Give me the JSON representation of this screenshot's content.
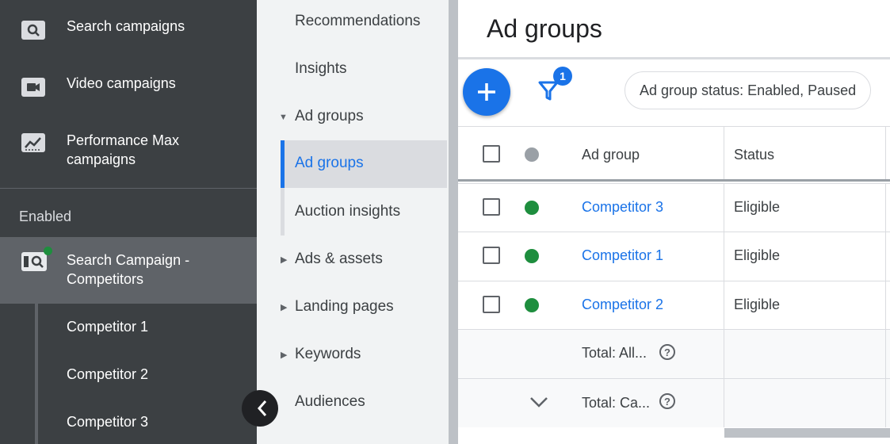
{
  "sidebar": {
    "campaign_types": [
      {
        "label_line1": "Search campaigns",
        "label_line2": "",
        "icon": "search-icon"
      },
      {
        "label_line1": "Video campaigns",
        "label_line2": "",
        "icon": "video-icon"
      },
      {
        "label_line1": "Performance Max",
        "label_line2": "campaigns",
        "icon": "performance-max-icon"
      }
    ],
    "section_label": "Enabled",
    "active_campaign": {
      "label_line1": "Search Campaign -",
      "label_line2": "Competitors",
      "status": "enabled"
    },
    "ad_groups": [
      "Competitor 1",
      "Competitor 2",
      "Competitor 3"
    ]
  },
  "nav": {
    "items": [
      {
        "label": "Recommendations"
      },
      {
        "label": "Insights"
      },
      {
        "label": "Ad groups",
        "expanded": true
      },
      {
        "label": "Ad groups",
        "selected": true
      },
      {
        "label": "Auction insights"
      },
      {
        "label": "Ads & assets",
        "expandable": true
      },
      {
        "label": "Landing pages",
        "expandable": true
      },
      {
        "label": "Keywords",
        "expandable": true
      },
      {
        "label": "Audiences"
      }
    ]
  },
  "main": {
    "title": "Ad groups",
    "filter_count": "1",
    "filter_chip": "Ad group status: Enabled, Paused",
    "table": {
      "headers": {
        "name": "Ad group",
        "status": "Status"
      },
      "rows": [
        {
          "name": "Competitor 3",
          "status": "Eligible"
        },
        {
          "name": "Competitor 1",
          "status": "Eligible"
        },
        {
          "name": "Competitor 2",
          "status": "Eligible"
        }
      ],
      "totals": [
        {
          "label": "Total: All..."
        },
        {
          "label": "Total: Ca..."
        }
      ]
    }
  },
  "colors": {
    "accent": "#1a73e8",
    "enabled_green": "#1e8e3e",
    "sidebar_bg": "#3c4043"
  }
}
